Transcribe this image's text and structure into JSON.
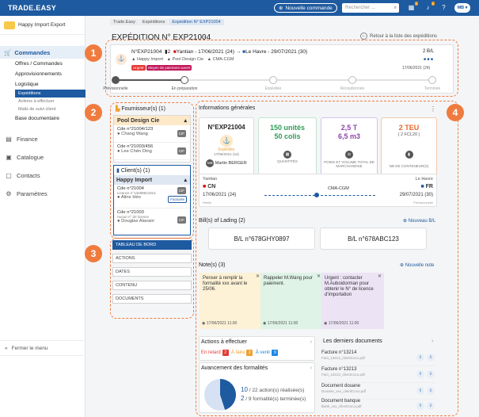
{
  "topbar": {
    "logo": "TRADE.EASY",
    "new_order": "Nouvelle commande",
    "search_placeholder": "Rechercher ...",
    "user_initials": "MB",
    "notif_count_1": "1",
    "notif_count_2": "2"
  },
  "sidebar": {
    "company": "Happy Import Export",
    "section": "Commandes",
    "items": [
      "Offres / Commandes",
      "Approvisionnements",
      "Logistique"
    ],
    "subitems": [
      "Expéditions",
      "Actions à effectuer",
      "Mails de suivi client"
    ],
    "doc_base": "Base documentaire",
    "nav": [
      {
        "icon": "finance-icon",
        "label": "Finance"
      },
      {
        "icon": "catalog-icon",
        "label": "Catalogue"
      },
      {
        "icon": "contacts-icon",
        "label": "Contacts"
      },
      {
        "icon": "settings-icon",
        "label": "Paramètres"
      }
    ],
    "close_menu": "Fermer le menu"
  },
  "breadcrumb": [
    "Trade.Easy",
    "Expéditions",
    "Expédition N° EXP21004"
  ],
  "page": {
    "title": "EXPÉDITION N° EXP21004",
    "back": "Retour à la liste des expéditions"
  },
  "annotations": [
    "1",
    "2",
    "3",
    "4"
  ],
  "header": {
    "ref": "N°EXP21004",
    "count": "2",
    "origin": "Yantian - 17/06/2021 (24)",
    "dest": "Le Havre - 29/07/2021 (30)",
    "client": "Happy Import",
    "supplier": "Pool Design Cie",
    "carrier": "CMA-CGM",
    "bl": "2 B/L",
    "date": "17/06/2021 (24)",
    "tags": [
      "Urgent",
      "Moyen de paiement ouvert"
    ],
    "steps": [
      "Prévisionnelle",
      "En préparation",
      "Expédiée",
      "Réceptionnée",
      "Terminée"
    ]
  },
  "suppliers": {
    "title": "Fournisseur(s) (1)",
    "name": "Pool Design Cie",
    "orders": [
      {
        "ref": "Cde n°21004/123",
        "contact": "Chang Wang",
        "tag": "CIF"
      },
      {
        "ref": "Cde n°21003/456",
        "contact": "Lee Chén Ding",
        "tag": "CIF"
      }
    ]
  },
  "clients": {
    "title": "Client(s) (1)",
    "name": "Happy Import",
    "orders": [
      {
        "ref": "Cde n°21004",
        "extra": "Licence n°13499914314",
        "contact": "Aline Héo",
        "tag": "CIF",
        "status": "Facturée"
      },
      {
        "ref": "Cde n°21003",
        "extra": "Aucun n° de licence",
        "contact": "Douglas Alavani",
        "tag": "CIF"
      }
    ]
  },
  "tabs": [
    "TABLEAU DE BORD",
    "ACTIONS",
    "DATES",
    "CONTENU",
    "DOCUMENTS"
  ],
  "general": {
    "title": "Informations générales",
    "ref": "N°EXP21004",
    "status": "Expédiée",
    "status_date": "17/06/2021 (24)",
    "owner_initials": "MB",
    "owner": "Martin BERGER",
    "qty_1": "150 unités",
    "qty_2": "50 colis",
    "qty_label": "QUANTITÉS",
    "weight_1": "2,5 T",
    "weight_2": "6,5 m3",
    "weight_label": "POIDS ET VOLUME TOTAL DE MARCHANDISE",
    "teu_1": "2 TEU",
    "teu_2": "( 2 FCL20 )",
    "teu_label": "NB DE CONTENEUR(S)",
    "route_from_city": "Yantian",
    "route_from_country": "CN",
    "route_from_date": "17/06/2021 (24)",
    "route_from_note": "Réelle",
    "route_carrier": "CMA-CGM",
    "route_to_city": "Le Havre",
    "route_to_country": "FR",
    "route_to_date": "29/07/2021 (30)",
    "route_to_note": "Prévisionnelle"
  },
  "bills": {
    "title": "Bill(s) of Lading (2)",
    "new": "Nouveau B/L",
    "items": [
      "B/L n°678GHY0897",
      "B/L n°678ABC123"
    ]
  },
  "notes": {
    "title": "Note(s) (3)",
    "new": "Nouvelle note",
    "items": [
      {
        "text": "Penser à remplir la formalité xxx avant le 25/06.",
        "date": "17/06/2021 11:00",
        "color": "#fdf1d6"
      },
      {
        "text": "Rappeler M.Wang pour paiement.",
        "date": "17/06/2021 11:00",
        "color": "#dff3e7"
      },
      {
        "text": "Urgent : contacter M.Auboidorman pour obtenir le N° de licence d'importation",
        "date": "17/06/2021 11:00",
        "color": "#ece3f5"
      }
    ]
  },
  "actions": {
    "title": "Actions à effectuer",
    "late": "En retard",
    "late_n": "2",
    "todo": "À faire",
    "todo_n": "2",
    "upcoming": "À venir",
    "upcoming_n": "9"
  },
  "progress": {
    "title": "Avancement des formalités",
    "done": "10",
    "total": "/ 22 action(s) réalisée(s)",
    "forms_done": "2",
    "forms_total": "/ 9 formalité(s) terminée(s)",
    "fraction": 0.45
  },
  "docs": {
    "title": "Les derniers documents",
    "items": [
      {
        "name": "Facture n°13214",
        "file": "Fact_13214_clientCoco.pdf"
      },
      {
        "name": "Facture n°13213",
        "file": "Fact_13213_clientCoco.pdf"
      },
      {
        "name": "Document douane",
        "file": "Douane_xxx_clientCoco.pdf"
      },
      {
        "name": "Document banque",
        "file": "Bank_xxx_clientCoco.pdf"
      }
    ]
  }
}
